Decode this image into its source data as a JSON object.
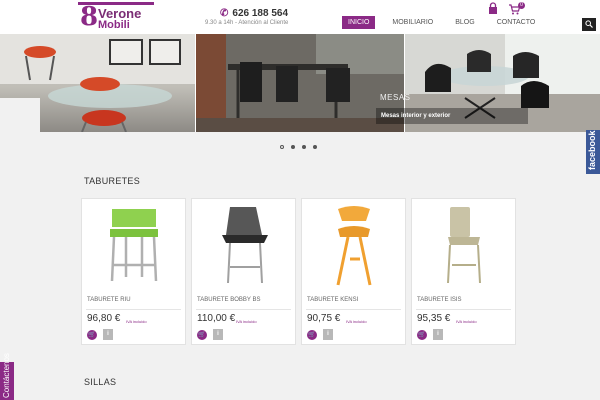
{
  "header": {
    "logo_line1": "Verone",
    "logo_line2": "Mobili",
    "phone": "626 188 564",
    "hours": "9.30 a 14h - Atención al Cliente",
    "cart_count": "0"
  },
  "nav": {
    "items": [
      {
        "label": "INICIO",
        "active": true
      },
      {
        "label": "MOBILIARIO",
        "active": false
      },
      {
        "label": "BLOG",
        "active": false
      },
      {
        "label": "CONTACTO",
        "active": false
      }
    ]
  },
  "slider": {
    "caption_title": "MESAS",
    "caption_subtitle": "Mesas interior y exterior",
    "slide_count": 4,
    "active_index": 0
  },
  "sections": {
    "taburetes_title": "TABURETES",
    "sillas_title": "SILLAS"
  },
  "products": [
    {
      "name": "TABURETE RIU",
      "price": "96,80 €",
      "iva": "IVA incluido",
      "color": "#8fd14f"
    },
    {
      "name": "TABURETE BOBBY BS",
      "price": "110,00 €",
      "iva": "IVA incluido",
      "color": "#3a3a3a"
    },
    {
      "name": "TABURETE KENSI",
      "price": "90,75 €",
      "iva": "IVA incluido",
      "color": "#f2a93b"
    },
    {
      "name": "TABURETE ISIS",
      "price": "95,35 €",
      "iva": "IVA incluido",
      "color": "#c9c3a6"
    }
  ],
  "side_tabs": {
    "facebook": "facebook",
    "contact": "Contáctenos"
  },
  "colors": {
    "brand": "#8b2a86",
    "facebook": "#3b5998"
  }
}
